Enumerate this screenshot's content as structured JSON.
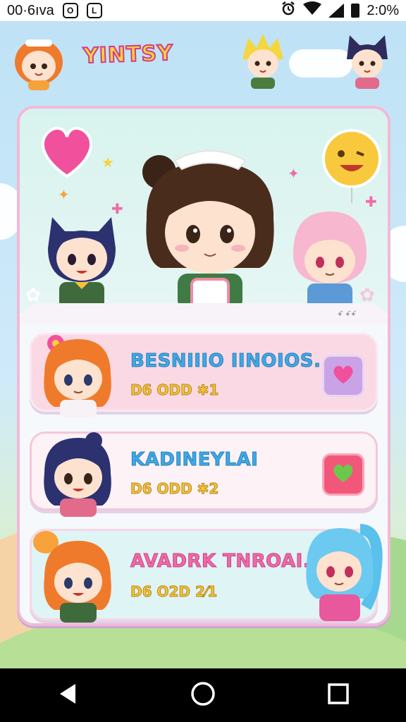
{
  "status_bar": {
    "left_text": "00·6ıᴠa",
    "left_icon_1": "O",
    "left_icon_2": "L",
    "time": "2:0%",
    "icons": [
      "alarm-icon",
      "wifi-icon",
      "signal-icon",
      "battery-icon"
    ]
  },
  "header": {
    "title": "YINTSY"
  },
  "hero": {
    "caption": "ꗃ ꗃꗃ"
  },
  "items": [
    {
      "title": "BESNIIIO IINOIOS.",
      "subtitle": "D6 ODD ✱1",
      "action_icon": "heart-icon"
    },
    {
      "title": "KADINEYLAI",
      "subtitle": "D6 ODD ✱2",
      "action_icon": "heart-icon"
    },
    {
      "title": "AVADRK TNROAI.",
      "subtitle": "D6 O2D 2⁄1"
    }
  ],
  "nav": {
    "icons": [
      "back-icon",
      "home-icon",
      "recents-icon"
    ]
  },
  "colors": {
    "background_sky": "#bfe2f6",
    "title_fill": "#f7d33a",
    "title_stroke": "#d23c8a",
    "item_title_blue": "#3ea9e6",
    "item_title_pink": "#f06aa8",
    "subtitle_yellow": "#f4c53a",
    "card_border": "#f2b9d6"
  }
}
